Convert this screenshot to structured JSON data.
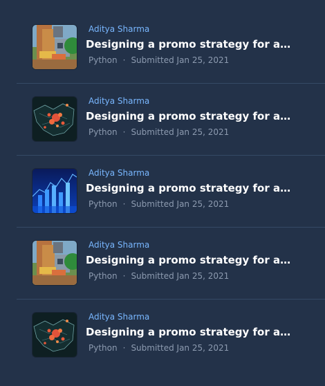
{
  "items": [
    {
      "author": "Aditya Sharma",
      "title": "Designing a promo strategy for a drink brand",
      "language": "Python",
      "submitted": "Submitted Jan 25, 2021",
      "thumbnail_icon": "game-scene-thumbnail-icon"
    },
    {
      "author": "Aditya Sharma",
      "title": "Designing a promo strategy for a drink brand",
      "language": "Python",
      "submitted": "Submitted Jan 25, 2021",
      "thumbnail_icon": "map-heat-thumbnail-icon"
    },
    {
      "author": "Aditya Sharma",
      "title": "Designing a promo strategy for a drink brand",
      "language": "Python",
      "submitted": "Submitted Jan 25, 2021",
      "thumbnail_icon": "blue-chart-thumbnail-icon"
    },
    {
      "author": "Aditya Sharma",
      "title": "Designing a promo strategy for a drink brand",
      "language": "Python",
      "submitted": "Submitted Jan 25, 2021",
      "thumbnail_icon": "game-scene-thumbnail-icon"
    },
    {
      "author": "Aditya Sharma",
      "title": "Designing a promo strategy for a drink brand",
      "language": "Python",
      "submitted": "Submitted Jan 25, 2021",
      "thumbnail_icon": "map-heat-thumbnail-icon"
    }
  ],
  "separator": "·",
  "colors": {
    "background": "#233249",
    "author": "#79b7ff",
    "title": "#ffffff",
    "meta": "#8d9bb0",
    "divider": "#354a66"
  }
}
